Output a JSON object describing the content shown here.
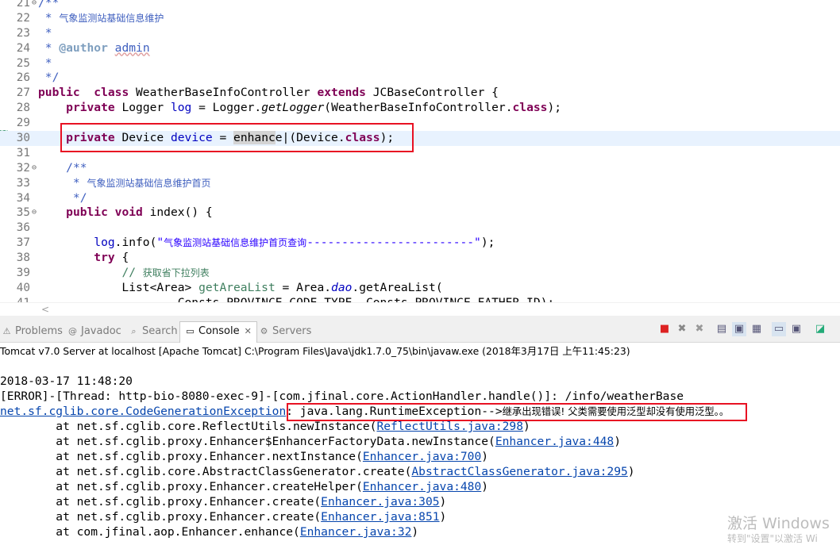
{
  "editor": {
    "lines": [
      {
        "n": "21",
        "fold": "⊖",
        "parts": [
          [
            "cmt",
            "/**"
          ]
        ]
      },
      {
        "n": "22",
        "parts": [
          [
            "cmt",
            " * "
          ],
          [
            "cmt zh",
            "气象监测站基础信息维护"
          ]
        ]
      },
      {
        "n": "23",
        "parts": [
          [
            "cmt",
            " *"
          ]
        ]
      },
      {
        "n": "24",
        "parts": [
          [
            "cmt",
            " * "
          ],
          [
            "tag",
            "@author"
          ],
          [
            "cmt",
            " "
          ],
          [
            "cmt squig",
            "admin"
          ]
        ]
      },
      {
        "n": "25",
        "parts": [
          [
            "cmt",
            " *"
          ]
        ]
      },
      {
        "n": "26",
        "parts": [
          [
            "cmt",
            " */"
          ]
        ]
      },
      {
        "n": "27",
        "parts": [
          [
            "kw",
            "public"
          ],
          [
            "",
            "  "
          ],
          [
            "kw",
            "class"
          ],
          [
            "",
            " WeatherBaseInfoController "
          ],
          [
            "kw",
            "extends"
          ],
          [
            "",
            " JCBaseController {"
          ]
        ]
      },
      {
        "n": "28",
        "parts": [
          [
            "",
            "    "
          ],
          [
            "kw",
            "private"
          ],
          [
            "",
            " Logger "
          ],
          [
            "fld",
            "log"
          ],
          [
            "",
            " = Logger."
          ],
          [
            "it",
            "getLogger"
          ],
          [
            "",
            "(WeatherBaseInfoController."
          ],
          [
            "kw",
            "class"
          ],
          [
            "",
            ");"
          ]
        ]
      },
      {
        "n": "29",
        "parts": []
      },
      {
        "n": "30",
        "current": true,
        "parts": [
          [
            "",
            "    "
          ],
          [
            "kw",
            "private"
          ],
          [
            "",
            " Device "
          ],
          [
            "fld",
            "device"
          ],
          [
            "",
            " = "
          ],
          [
            "sel",
            "enhanc"
          ],
          [
            "",
            "e|(Device."
          ],
          [
            "kw",
            "class"
          ],
          [
            "",
            ");"
          ]
        ]
      },
      {
        "n": "31",
        "parts": []
      },
      {
        "n": "32",
        "fold": "⊖",
        "parts": [
          [
            "",
            "    "
          ],
          [
            "cmt",
            "/**"
          ]
        ]
      },
      {
        "n": "33",
        "parts": [
          [
            "cmt",
            "     * "
          ],
          [
            "cmt zh",
            "气象监测站基础信息维护首页"
          ]
        ]
      },
      {
        "n": "34",
        "parts": [
          [
            "cmt",
            "     */"
          ]
        ]
      },
      {
        "n": "35",
        "fold": "⊖",
        "parts": [
          [
            "",
            "    "
          ],
          [
            "kw",
            "public"
          ],
          [
            "",
            ""
          ],
          [
            "kw",
            " void"
          ],
          [
            "",
            " index() {"
          ]
        ]
      },
      {
        "n": "36",
        "parts": []
      },
      {
        "n": "37",
        "parts": [
          [
            "",
            "        "
          ],
          [
            "fld",
            "log"
          ],
          [
            "",
            ".info("
          ],
          [
            "str",
            "\""
          ],
          [
            "str zh",
            "气象监测站基础信息维护首页查询"
          ],
          [
            "str",
            "------------------------\""
          ],
          [
            "",
            ");"
          ]
        ]
      },
      {
        "n": "38",
        "parts": [
          [
            "",
            "        "
          ],
          [
            "kw",
            "try"
          ],
          [
            "",
            " {"
          ]
        ]
      },
      {
        "n": "39",
        "parts": [
          [
            "",
            "            "
          ],
          [
            "lcmt",
            "// "
          ],
          [
            "lcmt zh",
            "获取省下拉列表"
          ]
        ]
      },
      {
        "n": "40",
        "parts": [
          [
            "",
            "            List<Area> "
          ],
          [
            "lcmt",
            "getAreaList"
          ],
          [
            "",
            " = Area."
          ],
          [
            "fld it",
            "dao"
          ],
          [
            "",
            ".getAreaList("
          ]
        ]
      },
      {
        "n": "41",
        "parts": [
          [
            "",
            "                    Consts.PROVINCE_CODE_TYPE, Consts.PROVINCE_FATHER_ID);"
          ]
        ]
      }
    ]
  },
  "console": {
    "tabs": [
      {
        "label": "Problems",
        "icon": "⚠"
      },
      {
        "label": "Javadoc",
        "icon": "@"
      },
      {
        "label": "Search",
        "icon": "⌕"
      },
      {
        "label": "Console",
        "icon": "▭",
        "close": "✕"
      },
      {
        "label": "Servers",
        "icon": "⚙"
      }
    ],
    "launch": "Tomcat v7.0 Server at localhost [Apache Tomcat] C:\\Program Files\\Java\\jdk1.7.0_75\\bin\\javaw.exe (2018年3月17日 上午11:45:23)",
    "timestamp": "2018-03-17 11:48:20",
    "error_line": "[ERROR]-[Thread: http-bio-8080-exec-9]-[com.jfinal.core.ActionHandler.handle()]: /info/weatherBase",
    "exception_link": "net.sf.cglib.core.CodeGenerationException",
    "exception_msg_pre": ": java.lang.RuntimeException-->",
    "exception_msg_zh": "继承出现错误! 父类需要使用泛型却没有使用泛型。。",
    "stack": [
      {
        "pre": "\tat net.sf.cglib.core.ReflectUtils.newInstance(",
        "link": "ReflectUtils.java:298",
        "post": ")"
      },
      {
        "pre": "\tat net.sf.cglib.proxy.Enhancer$EnhancerFactoryData.newInstance(",
        "link": "Enhancer.java:448",
        "post": ")"
      },
      {
        "pre": "\tat net.sf.cglib.proxy.Enhancer.nextInstance(",
        "link": "Enhancer.java:700",
        "post": ")"
      },
      {
        "pre": "\tat net.sf.cglib.core.AbstractClassGenerator.create(",
        "link": "AbstractClassGenerator.java:295",
        "post": ")"
      },
      {
        "pre": "\tat net.sf.cglib.proxy.Enhancer.createHelper(",
        "link": "Enhancer.java:480",
        "post": ")"
      },
      {
        "pre": "\tat net.sf.cglib.proxy.Enhancer.create(",
        "link": "Enhancer.java:305",
        "post": ")"
      },
      {
        "pre": "\tat net.sf.cglib.proxy.Enhancer.create(",
        "link": "Enhancer.java:851",
        "post": ")"
      },
      {
        "pre": "\tat com.jfinal.aop.Enhancer.enhance(",
        "link": "Enhancer.java:32",
        "post": ")"
      }
    ]
  },
  "watermark": {
    "line1": "激活 Windows",
    "line2": "转到\"设置\"以激活 Wi"
  },
  "colors": {
    "highlight_box": "#e81123",
    "keyword": "#7f0055",
    "javadoc": "#3f5fbf",
    "link": "#0645ad"
  }
}
